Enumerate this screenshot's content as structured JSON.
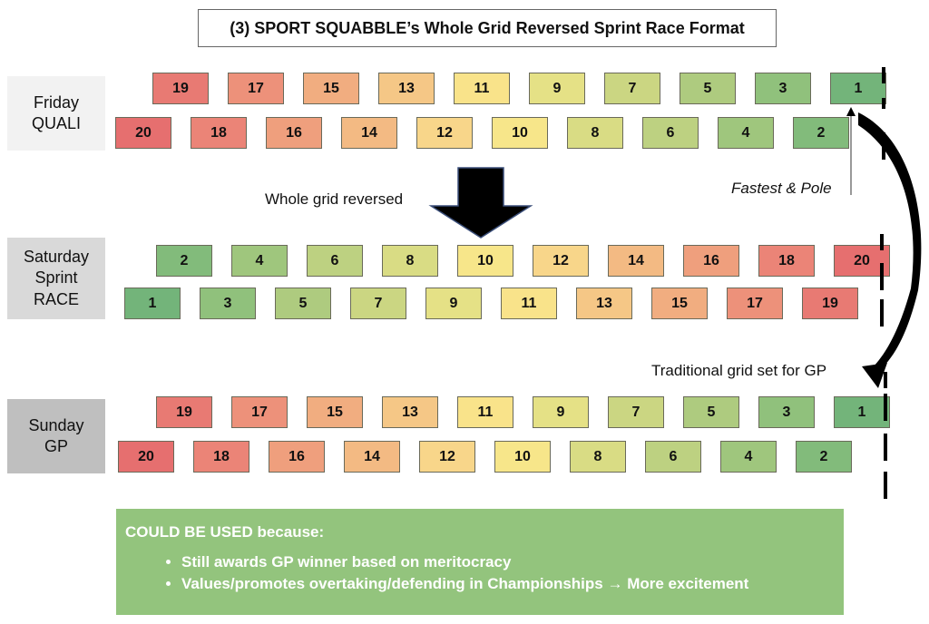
{
  "title": "(3) SPORT SQUABBLE’s Whole Grid Reversed Sprint Race Format",
  "days": [
    {
      "label": "Friday\nQUALI",
      "top_row": [
        19,
        17,
        15,
        13,
        11,
        9,
        7,
        5,
        3,
        1
      ],
      "bottom_row": [
        20,
        18,
        16,
        14,
        12,
        10,
        8,
        6,
        4,
        2
      ]
    },
    {
      "label": "Saturday\nSprint\nRACE",
      "top_row": [
        2,
        4,
        6,
        8,
        10,
        12,
        14,
        16,
        18,
        20
      ],
      "bottom_row": [
        1,
        3,
        5,
        7,
        9,
        11,
        13,
        15,
        17,
        19
      ]
    },
    {
      "label": "Sunday\nGP",
      "top_row": [
        19,
        17,
        15,
        13,
        11,
        9,
        7,
        5,
        3,
        1
      ],
      "bottom_row": [
        20,
        18,
        16,
        14,
        12,
        10,
        8,
        6,
        4,
        2
      ]
    }
  ],
  "position_colors": {
    "1": "#73b47a",
    "2": "#82bb7b",
    "3": "#90c17c",
    "4": "#9fc67d",
    "5": "#aecb7f",
    "6": "#bdd181",
    "7": "#cbd682",
    "8": "#d9dc84",
    "9": "#e5e186",
    "10": "#f7e68a",
    "11": "#f9e38a",
    "12": "#f8d68a",
    "13": "#f5c786",
    "14": "#f3ba83",
    "15": "#f1ad80",
    "16": "#ef9f7d",
    "17": "#ed917a",
    "18": "#eb8477",
    "19": "#e87a73",
    "20": "#e66f6f"
  },
  "label_colors": {
    "friday": "#f2f2f2",
    "saturday": "#d9d9d9",
    "sunday": "#bfbfbf"
  },
  "annotations": {
    "fastest_pole": "Fastest & Pole",
    "whole_grid_reversed": "Whole grid reversed",
    "traditional_grid": "Traditional grid set for GP"
  },
  "reasons": {
    "heading": "COULD BE USED because:",
    "items": [
      "Still awards GP winner based on meritocracy",
      "Values/promotes overtaking/defending in Championships → More excitement"
    ],
    "color": "#93c47d"
  }
}
